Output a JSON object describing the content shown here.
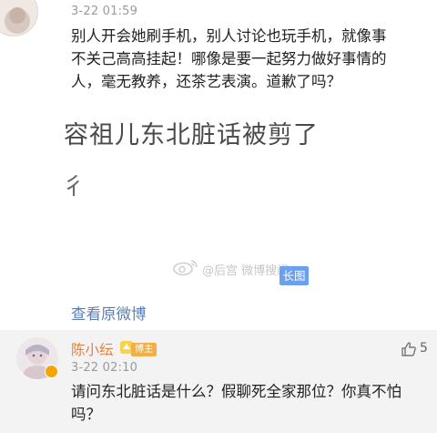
{
  "comment1": {
    "time": "3-22 01:59",
    "lines": [
      "别人开会她刷手机，别人讨论也玩手机，就像事",
      "不关己高高挂起！哪像是要一起努力做好事情的",
      "人，毫无教养，还茶艺表演。道歉了吗？"
    ],
    "image": {
      "text_line1": "容祖儿东北脏话被剪了",
      "text_line2": "⼻",
      "watermark": "@后宫 微博搜问",
      "long_badge": "长图"
    },
    "view_original": "查看原微博"
  },
  "comment2": {
    "username": "陈小纭",
    "tag": "博主",
    "time": "3-22 02:10",
    "lines": [
      "请问东北脏话是什么？假聊死全家那位？你真不怕",
      "吗？"
    ],
    "like_count": "5"
  },
  "colors": {
    "username": "#e3803a",
    "link": "#5b7fb0",
    "badge": "#6b9ff0",
    "tag": "#f0b043"
  }
}
